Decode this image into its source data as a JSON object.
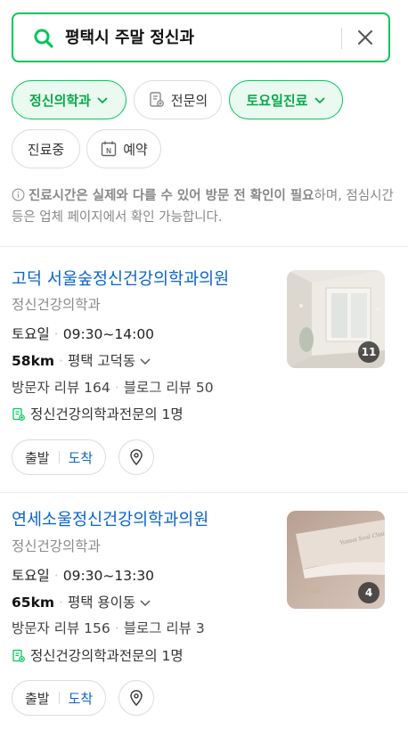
{
  "search": {
    "query": "평택시 주말 정신과",
    "icon": "search-icon",
    "clear_icon": "close-icon",
    "accent_color": "#03c75a"
  },
  "filters": [
    {
      "label": "정신의학과",
      "active": true,
      "has_dropdown": true
    },
    {
      "label": "전문의",
      "active": false,
      "icon": "specialist-icon"
    },
    {
      "label": "토요일진료",
      "active": true,
      "has_dropdown": true
    },
    {
      "label": "진료중",
      "active": false
    },
    {
      "label": "예약",
      "active": false,
      "icon": "naver-booking-icon"
    }
  ],
  "notice": {
    "bold": "진료시간은 실제와 다를 수 있어 방문 전 확인이 필요",
    "rest": "하며, 점심시간 등은 업체 페이지에서 확인 가능합니다."
  },
  "results": [
    {
      "name": "고덕 서울숲정신건강의학과의원",
      "category": "정신건강의학과",
      "day": "토요일",
      "hours": "09:30~14:00",
      "distance": "58km",
      "location": "평택 고덕동",
      "visitor_reviews": "방문자 리뷰 164",
      "blog_reviews": "블로그 리뷰 50",
      "specialist": "정신건강의학과전문의 1명",
      "photo_count": "11",
      "start_label": "출발",
      "arrive_label": "도착"
    },
    {
      "name": "연세소울정신건강의학과의원",
      "category": "정신건강의학과",
      "day": "토요일",
      "hours": "09:30~13:30",
      "distance": "65km",
      "location": "평택 용이동",
      "visitor_reviews": "방문자 리뷰 156",
      "blog_reviews": "블로그 리뷰 3",
      "specialist": "정신건강의학과전문의 1명",
      "photo_count": "4",
      "start_label": "출발",
      "arrive_label": "도착"
    }
  ],
  "colors": {
    "link_blue": "#0b64c8",
    "active_chip_bg": "#ebfaf1",
    "active_chip_text": "#08a849"
  }
}
